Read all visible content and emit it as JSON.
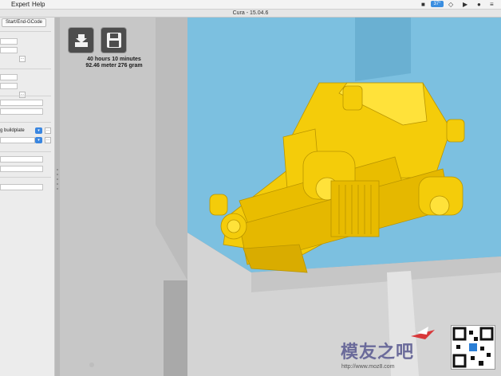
{
  "menubar": {
    "items": [
      "Expert",
      "Help"
    ],
    "clock": "⌘",
    "battery": "37°",
    "tray_icons": [
      "notification-icon",
      "wifi-icon",
      "user-icon"
    ]
  },
  "window": {
    "title": "Cura - 15.04.6"
  },
  "sidebar": {
    "tab_label": "Start/End-GCode",
    "support_label": "g buildplate",
    "ellipsis": "...",
    "select_arrow": "▾"
  },
  "viewport": {
    "tools": [
      "load-model-icon",
      "save-gcode-icon"
    ],
    "info_line1": "40 hours 10 minutes",
    "info_line2": "92.46 meter 276 gram",
    "colors": {
      "sky": "#7cc0e0",
      "model": "#f4cc0a",
      "floor": "#d4d4d4",
      "wall": "#c8c8c8"
    }
  },
  "watermark": {
    "text": "模友之吧",
    "url": "http://www.moz8.com"
  }
}
